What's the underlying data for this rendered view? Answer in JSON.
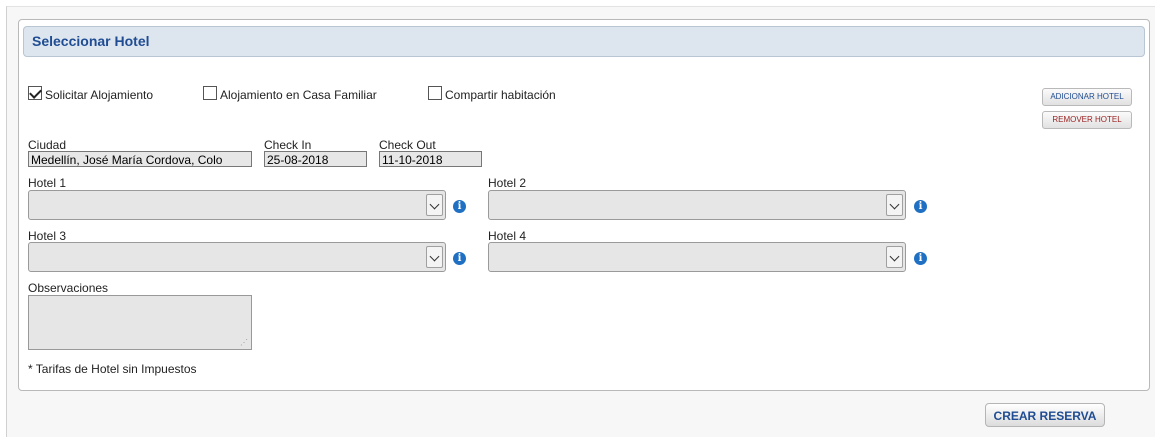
{
  "section": {
    "title": "Seleccionar Hotel"
  },
  "options": [
    {
      "label": "Solicitar Alojamiento",
      "checked": true
    },
    {
      "label": "Alojamiento en Casa Familiar",
      "checked": false
    },
    {
      "label": "Compartir habitación",
      "checked": false
    }
  ],
  "buttons": {
    "add_hotel": "ADICIONAR HOTEL",
    "remove_hotel": "REMOVER HOTEL",
    "create_booking": "CREAR RESERVA"
  },
  "fields": {
    "city": {
      "label": "Ciudad",
      "value": "Medellín, José María Cordova, Colo"
    },
    "check_in": {
      "label": "Check In",
      "value": "25-08-2018"
    },
    "check_out": {
      "label": "Check Out",
      "value": "11-10-2018"
    }
  },
  "hotels": [
    {
      "label": "Hotel 1",
      "value": ""
    },
    {
      "label": "Hotel 2",
      "value": ""
    },
    {
      "label": "Hotel 3",
      "value": ""
    },
    {
      "label": "Hotel 4",
      "value": ""
    }
  ],
  "observations": {
    "label": "Observaciones",
    "value": ""
  },
  "note": "* Tarifas de Hotel sin Impuestos",
  "icons": {
    "checkbox_checked": "checkbox-checked-icon",
    "checkbox_unchecked": "checkbox-unchecked-icon",
    "dropdown": "chevron-down-icon",
    "info": "info-icon",
    "resize": "resize-grip-icon"
  },
  "colors": {
    "header_bg": "#dde6ee",
    "title_text": "#1f4c93",
    "info_icon": "#1f6fc3",
    "remove_text": "#9a1f1f"
  }
}
